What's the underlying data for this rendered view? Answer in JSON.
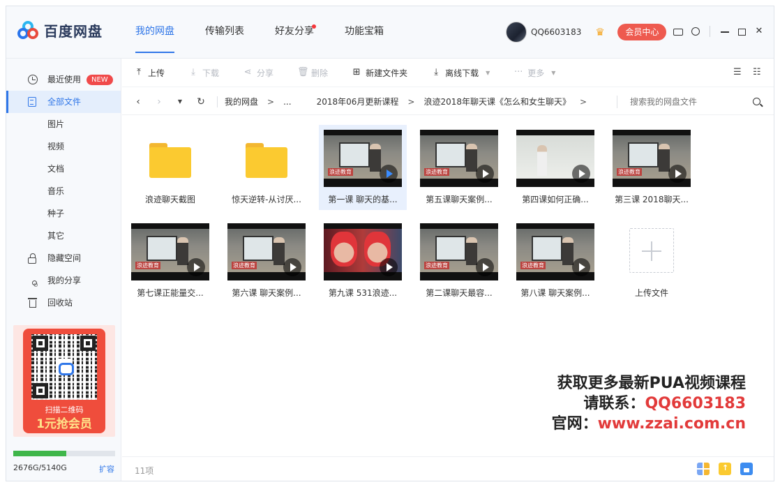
{
  "app": {
    "name": "百度网盘"
  },
  "topnav": [
    {
      "label": "我的网盘",
      "active": true
    },
    {
      "label": "传输列表",
      "active": false
    },
    {
      "label": "好友分享",
      "active": false,
      "dot": true
    },
    {
      "label": "功能宝箱",
      "active": false
    }
  ],
  "user": {
    "name": "QQ6603183",
    "vip_label": "会员中心"
  },
  "sidebar": {
    "items": [
      {
        "label": "最近使用",
        "icon": "clock-icon",
        "badge": "NEW"
      },
      {
        "label": "全部文件",
        "icon": "document-icon",
        "active": true
      },
      {
        "label": "图片"
      },
      {
        "label": "视频"
      },
      {
        "label": "文档"
      },
      {
        "label": "音乐"
      },
      {
        "label": "种子"
      },
      {
        "label": "其它"
      },
      {
        "label": "隐藏空间",
        "icon": "lock-icon"
      },
      {
        "label": "我的分享",
        "icon": "share-icon"
      },
      {
        "label": "回收站",
        "icon": "trash-icon"
      }
    ],
    "promo": {
      "line1": "扫描二维码",
      "line2": "1元抢会员"
    },
    "quota": {
      "text": "2676G/5140G",
      "used_fraction": 0.52,
      "expand": "扩容"
    }
  },
  "toolbar": {
    "upload": "上传",
    "download": "下载",
    "share": "分享",
    "delete": "删除",
    "new_folder": "新建文件夹",
    "offline": "离线下载",
    "more": "更多"
  },
  "breadcrumb": {
    "root": "我的网盘",
    "ellipsis": "...",
    "level1": "2018年06月更新课程",
    "level2": "浪迹2018年聊天课《怎么和女生聊天》",
    "search_placeholder": "搜索我的网盘文件"
  },
  "files": [
    {
      "name": "浪迹聊天截图",
      "type": "folder"
    },
    {
      "name": "惊天逆转-从讨厌...",
      "type": "folder"
    },
    {
      "name": "第一课 聊天的基...",
      "type": "video",
      "scene": "classroom",
      "selected": true
    },
    {
      "name": "第五课聊天案例...",
      "type": "video",
      "scene": "classroom"
    },
    {
      "name": "第四课如何正确...",
      "type": "video",
      "scene": "whiteboard"
    },
    {
      "name": "第三课 2018聊天...",
      "type": "video",
      "scene": "classroom"
    },
    {
      "name": "第七课正能量交...",
      "type": "video",
      "scene": "classroom"
    },
    {
      "name": "第六课 聊天案例...",
      "type": "video",
      "scene": "classroom"
    },
    {
      "name": "第九课 531浪迹...",
      "type": "video",
      "scene": "redhair"
    },
    {
      "name": "第二课聊天最容...",
      "type": "video",
      "scene": "classroom"
    },
    {
      "name": "第八课 聊天案例...",
      "type": "video",
      "scene": "classroom"
    },
    {
      "name": "上传文件",
      "type": "upload"
    }
  ],
  "watermark_tag": "浪迹教育",
  "overlay": {
    "line1": "获取更多最新PUA视频课程",
    "line2_prefix": "请联系：",
    "line2_value": "QQ6603183",
    "line3_prefix": "官网：",
    "line3_value": "www.zzai.com.cn"
  },
  "status": {
    "count": "11项"
  },
  "colors": {
    "accent": "#2f76e8",
    "vip": "#ee5a4f",
    "badge": "#f04a4a",
    "overlay_red": "#e23a3a"
  }
}
